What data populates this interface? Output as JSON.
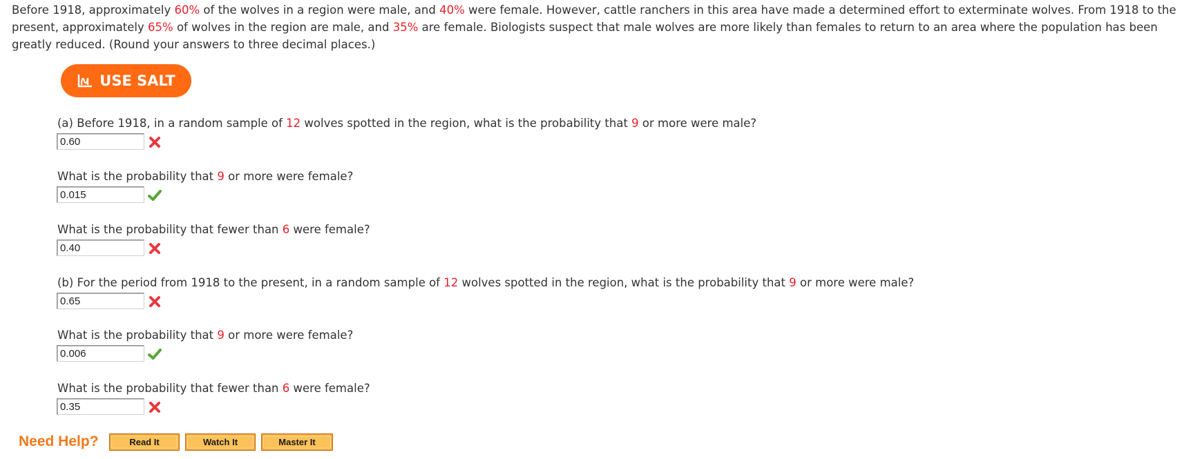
{
  "intro": {
    "p1": "Before 1918, approximately ",
    "pct_male_before": "60%",
    "p2": " of the wolves in a region were male, and ",
    "pct_female_before": "40%",
    "p3": " were female. However, cattle ranchers in this area have made a determined effort to exterminate wolves. From 1918 to the present, approximately ",
    "pct_male_after": "65%",
    "p4": " of wolves in the region are male, and ",
    "pct_female_after": "35%",
    "p5": " are female. Biologists suspect that male wolves are more likely than females to return to an area where the population has been greatly reduced. (Round your answers to three decimal places.)"
  },
  "salt_button": {
    "label": "USE SALT",
    "icon": "salt-chart-icon",
    "color": "#ff6a13"
  },
  "questions": [
    {
      "pre": "(a) Before 1918, in a random sample of ",
      "n": "12",
      "mid": " wolves spotted in the region, what is the probability that ",
      "k": "9",
      "post": " or more were male?",
      "answer": "0.60",
      "status": "incorrect"
    },
    {
      "pre": "What is the probability that ",
      "k": "9",
      "post": " or more were female?",
      "answer": "0.015",
      "status": "correct"
    },
    {
      "pre": "What is the probability that fewer than ",
      "k": "6",
      "post": " were female?",
      "answer": "0.40",
      "status": "incorrect"
    },
    {
      "pre": "(b) For the period from 1918 to the present, in a random sample of ",
      "n": "12",
      "mid": " wolves spotted in the region, what is the probability that ",
      "k": "9",
      "post": " or more were male?",
      "answer": "0.65",
      "status": "incorrect"
    },
    {
      "pre": "What is the probability that ",
      "k": "9",
      "post": " or more were female?",
      "answer": "0.006",
      "status": "correct"
    },
    {
      "pre": "What is the probability that fewer than ",
      "k": "6",
      "post": " were female?",
      "answer": "0.35",
      "status": "incorrect"
    }
  ],
  "help": {
    "label": "Need Help?",
    "buttons": [
      "Read It",
      "Watch It",
      "Master It"
    ]
  },
  "colors": {
    "highlight": "#e8202a",
    "correct": "#5aa63a",
    "incorrect": "#e8383d",
    "help": "#f07a1a"
  }
}
